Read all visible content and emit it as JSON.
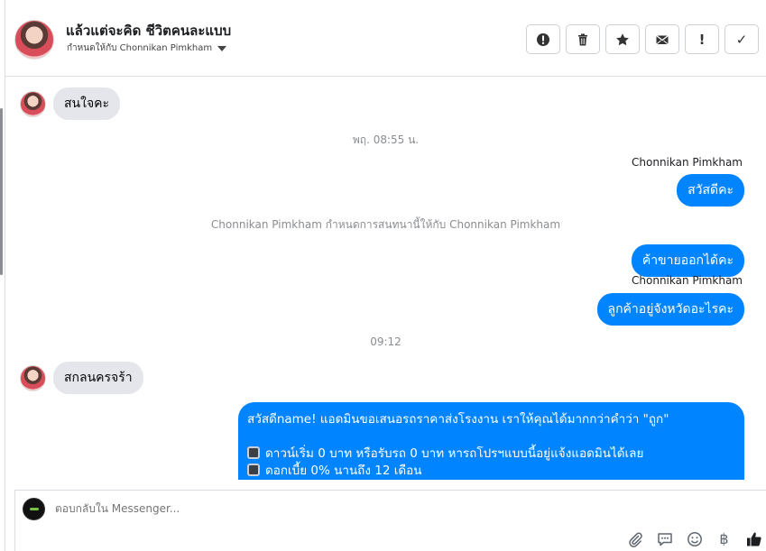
{
  "header": {
    "title": "แล้วแต่จะคิด ชีวิตคนละแบบ",
    "assigned_label": "กำหนดให้กับ Chonnikan Pimkham",
    "actions": [
      {
        "name": "spam-button",
        "icon": "alert-circle-icon"
      },
      {
        "name": "delete-button",
        "icon": "trash-icon"
      },
      {
        "name": "star-button",
        "icon": "star-icon"
      },
      {
        "name": "mark-unread-button",
        "icon": "envelope-icon"
      },
      {
        "name": "follow-up-button",
        "icon": "exclamation-icon",
        "glyph": "!"
      },
      {
        "name": "mark-done-button",
        "icon": "check-icon",
        "glyph": "✓"
      }
    ]
  },
  "thread": {
    "msg_in_1": "สนใจคะ",
    "time_1": "พฤ. 08:55 น.",
    "sender_1": "Chonnikan Pimkham",
    "msg_out_1": "สวัสดีคะ",
    "system_1": "Chonnikan Pimkham กำหนดการสนทนานี้ให้กับ Chonnikan Pimkham",
    "msg_out_2": "ค้าขายออกได้คะ",
    "sender_2": "Chonnikan Pimkham",
    "msg_out_3": "ลูกค้าอยู่จังหวัดอะไรคะ",
    "time_2": "09:12",
    "msg_in_2": "สกลนครจร้า",
    "long_message": {
      "line1": "สวัสดีname! แอดมินขอเสนอรถราคาส่งโรงงาน เราให้คุณได้มากกว่าคำว่า \"ถูก\"",
      "line2": "ดาวน์เริ่ม 0 บาท หรือรับรถ 0 บาท หารถโปรฯแบบนี้อยู่แจ้งแอดมินได้เลย",
      "line3": "ดอกเบี้ย 0% นานถึง 12 เดือน"
    }
  },
  "composer": {
    "placeholder": "ตอบกลับใน Messenger...",
    "tools": [
      "paperclip-icon",
      "saved-reply-icon",
      "emoji-icon",
      "baht-icon",
      "thumbs-up-icon"
    ],
    "baht_glyph": "฿"
  },
  "colors": {
    "outgoing_bubble": "#0084ff",
    "incoming_bubble": "#e4e6eb",
    "meta_text": "#8a8d91"
  }
}
